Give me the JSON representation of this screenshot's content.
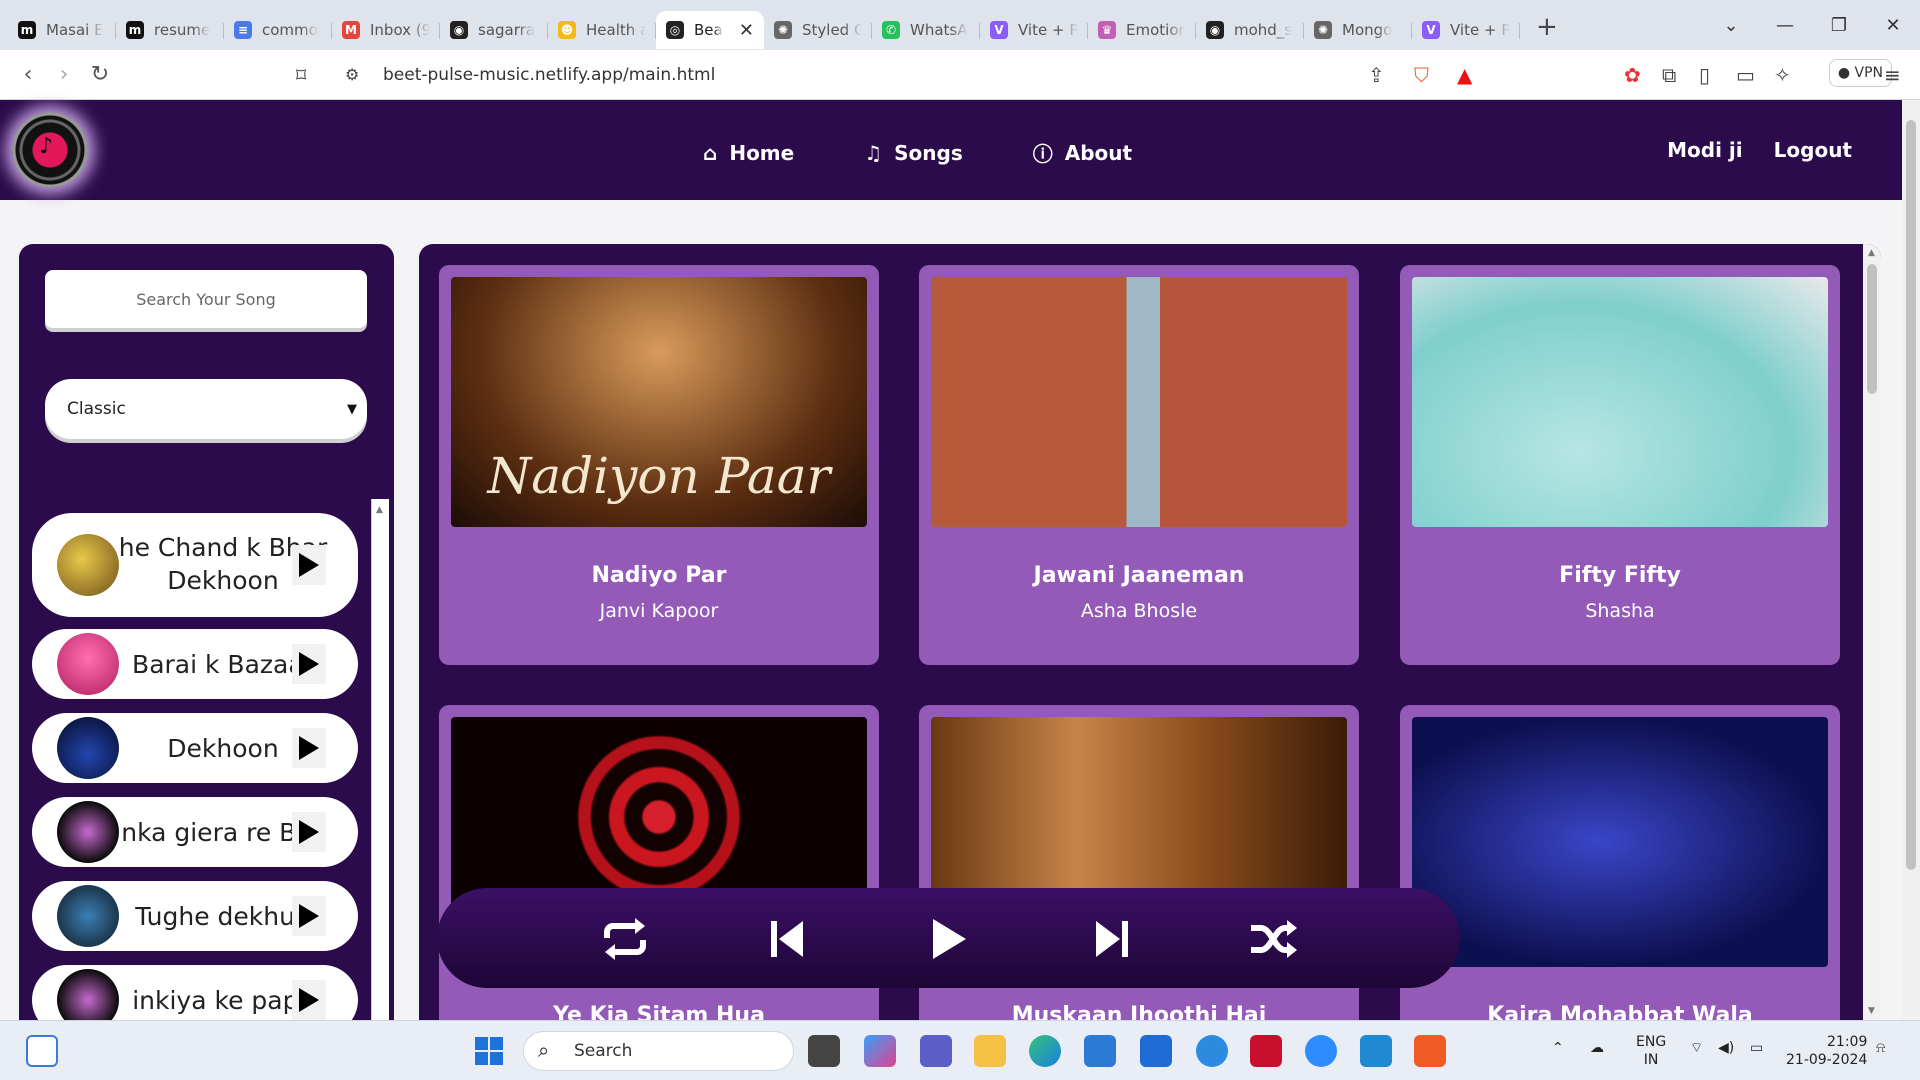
{
  "browser": {
    "tabs": [
      {
        "title": "Masai E",
        "fav": "m",
        "color": "#111"
      },
      {
        "title": "resume",
        "fav": "m",
        "color": "#111"
      },
      {
        "title": "commo",
        "fav": "≡",
        "color": "#4a7be8"
      },
      {
        "title": "Inbox (9",
        "fav": "M",
        "color": "#e5463b"
      },
      {
        "title": "sagarra",
        "fav": "◉",
        "color": "#222"
      },
      {
        "title": "Health a",
        "fav": "☻",
        "color": "#f3b819"
      },
      {
        "title": "Bea",
        "fav": "◎",
        "color": "#222"
      },
      {
        "title": "Styled C",
        "fav": "✺",
        "color": "#666"
      },
      {
        "title": "WhatsA",
        "fav": "✆",
        "color": "#25c25b"
      },
      {
        "title": "Vite + R",
        "fav": "V",
        "color": "#8b5cf6"
      },
      {
        "title": "Emotior",
        "fav": "♛",
        "color": "#c25fb4"
      },
      {
        "title": "mohd_s",
        "fav": "◉",
        "color": "#222"
      },
      {
        "title": "Mongo",
        "fav": "✺",
        "color": "#666"
      },
      {
        "title": "Vite + R",
        "fav": "V",
        "color": "#8b5cf6"
      }
    ],
    "active_tab_index": 6,
    "url": "beet-pulse-music.netlify.app/main.html",
    "vpn_label": "VPN"
  },
  "nav": {
    "home": "Home",
    "songs": "Songs",
    "about": "About",
    "user": "Modi ji",
    "logout": "Logout"
  },
  "sidebar": {
    "search_placeholder": "Search Your Song",
    "genre_selected": "Classic",
    "songs": [
      {
        "name": "he Chand k Bhar Dekhoon"
      },
      {
        "name": "Barai k Bazaar"
      },
      {
        "name": "Dekhoon"
      },
      {
        "name": "nka giera re Baz"
      },
      {
        "name": "Tughe dekhun"
      },
      {
        "name": "inkiya ke papa"
      }
    ]
  },
  "cards": [
    {
      "title": "Nadiyo Par",
      "artist": "Janvi Kapoor",
      "art_text": "Nadiyon Paar"
    },
    {
      "title": "Jawani Jaaneman",
      "artist": "Asha Bhosle",
      "art_text": ""
    },
    {
      "title": "Fifty Fifty",
      "artist": "Shasha",
      "art_text": ""
    },
    {
      "title": "Ye Kia Sitam Hua",
      "artist": "",
      "art_text": ""
    },
    {
      "title": "Muskaan Jhoothi Hai",
      "artist": "",
      "art_text": ""
    },
    {
      "title": "Kajra Mohabbat Wala",
      "artist": "",
      "art_text": ""
    }
  ],
  "taskbar": {
    "search_placeholder": "Search",
    "lang": "ENG",
    "region": "IN",
    "time": "21:09",
    "date": "21-09-2024"
  }
}
